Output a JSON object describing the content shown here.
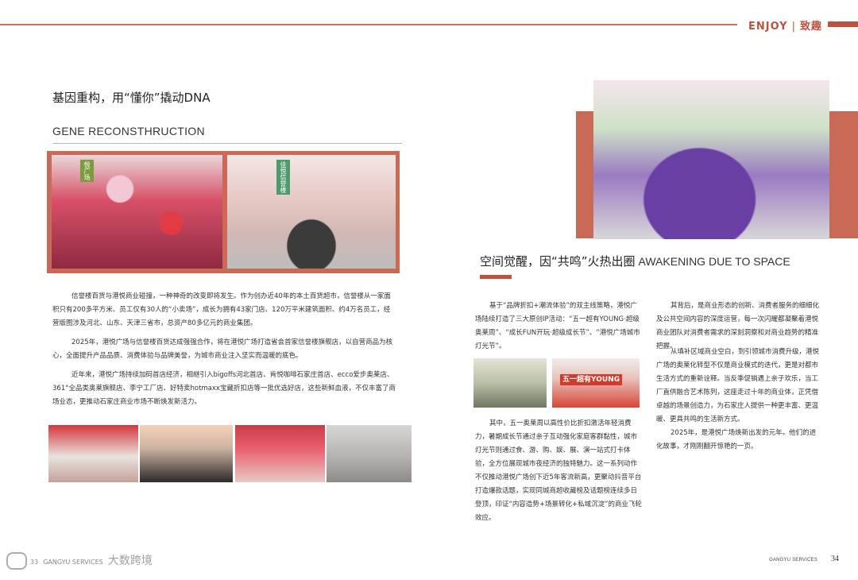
{
  "header": {
    "section_en": "ENJOY",
    "separator": "|",
    "section_cn": "致趣"
  },
  "left": {
    "title": "基因重构，用“懂你”撬动DNA",
    "subtitle": "GENE RECONSTHRUCTION",
    "photo1_tag": "悦广场",
    "photo2_tag": "佳悦信誉楼",
    "para1": "信誉楼百货与港悦商业碰撞，一种神奇的改变即将发生。作为创办近40年的本土百货超市，信誉楼从一家面积只有200多平方米、员工仅有30人的“小卖场”，成长为拥有43家门店、120万平米建筑面积、约4万名员工，经营版图涉及河北、山东、天津三省市，总资产80多亿元的商业集团。",
    "para2": "2025年，港悦广场与信誉楼百货达成强强合作，将在港悦广场打造省会首家信誉楼旗舰店，以自营商品为核心，全面提升产品品质、消费体验与品牌美誉，为城市商业注入坚实而温暖的底色。",
    "para3": "近年来，港悦广场持续加码首店经济，相继引入bigoffs河北首店、肯悦咖啡石家庄首店、ecco爱步奥莱店、361°全品类奥莱旗舰店、李宁工厂店、好特卖hotmaxx宝藏折扣店等一批优选好店，这些新鲜血液，不仅丰富了商场业态，更推动石家庄商业市场不断焕发新活力。"
  },
  "right": {
    "title_cn": "空间觉醒，因“共鸣”火热出圈",
    "title_en": "AWAKENING DUE TO SPACE",
    "col1_para1": "基于“品牌折扣+潮流体验”的双主线策略，港悦广场陆续打造了三大原创IP活动：“五一超有YOUNG·超级奥莱周”、“成长FUN开玩·超级成长节”、“港悦广场城市灯光节”。",
    "mid_badge": "五一超有YOUNG",
    "col1_para2": "其中，五一奥莱周以高性价比折扣激活年轻消费力，暑期成长节通过亲子互动强化家庭客群黏性，城市灯光节则通过食、游、购、娱、展、演一站式打卡体验，全方位展现城市夜经济的独特魅力。这一系列动作不仅推动港悦广场创下近5年客流新高，更聚动抖音平台打造爆款话题，实现同城商超收藏榜及话题榜连续多日登顶，印证“内容造势+场景转化+私域沉淀”的商业飞轮效应。",
    "col2_para1": "其背后，是商业形态的创新、消费者服务的细细化及公共空间内容的深度运营，每一次闪耀都凝聚着港悦商业团队对消费者需求的深刻洞察和对商业趋势的精准把握。",
    "col2_para2": "从填补区域商业空白，到引领城市消费升级，港悦广场的奥莱化转型不仅是商业模式的迭代，更是对都市生活方式的重新诠释。当反季促销遇上亲子欢乐，当工厂直供融合艺术陈列，这座走过十年的商业体，正凭借卓越的场景创造力，为石家庄人提供一种更丰富、更温暖、更具共鸣的生活新方式。",
    "col2_para3": "2025年，是港悦广场焕新出发的元年。他们的进化故事，才刚刚翻开惊艳的一页。"
  },
  "footer": {
    "watermark": "大数跨境",
    "left_page": "33",
    "left_brand": "GANGYU SERVICES",
    "right_brand": "GANGYU SERVICES",
    "page_number": "34"
  }
}
